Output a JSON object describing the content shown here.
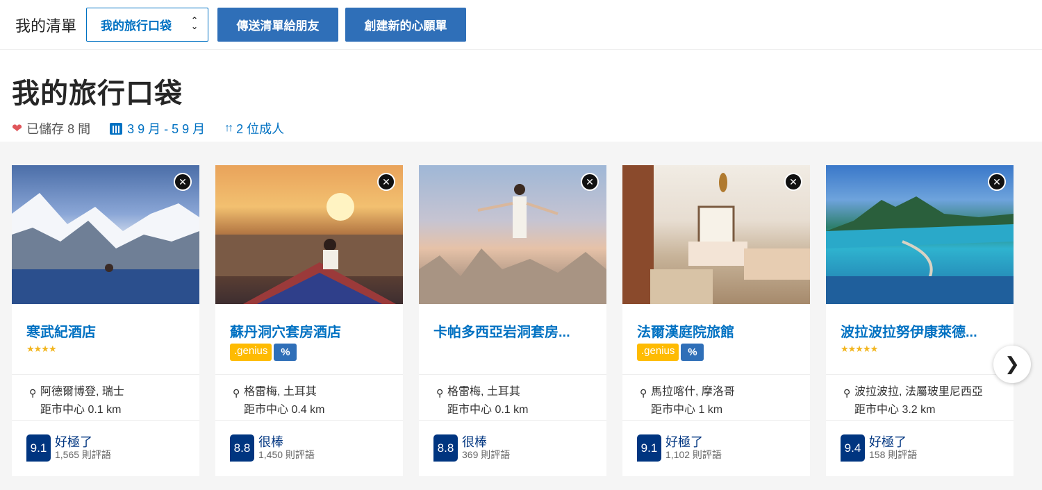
{
  "topbar": {
    "list_label": "我的清單",
    "select_value": "我的旅行口袋",
    "send_button": "傳送清單給朋友",
    "create_button": "創建新的心願單"
  },
  "header": {
    "title": "我的旅行口袋",
    "saved": "已儲存 8 間",
    "dates": "3 9 月 - 5 9 月",
    "guests": "2 位成人"
  },
  "cards": [
    {
      "name": "寒武紀酒店",
      "stars": "★★★★",
      "genius": "",
      "percent": "",
      "location": "阿德爾博登, 瑞士",
      "distance": "距市中心 0.1 km",
      "score": "9.1",
      "score_word": "好極了",
      "reviews": "1,565 則評語"
    },
    {
      "name": "蘇丹洞穴套房酒店",
      "stars": "",
      "genius": ".genius",
      "percent": "%",
      "location": "格雷梅, 土耳其",
      "distance": "距市中心 0.4 km",
      "score": "8.8",
      "score_word": "很棒",
      "reviews": "1,450 則評語"
    },
    {
      "name": "卡帕多西亞岩洞套房...",
      "stars": "",
      "genius": "",
      "percent": "",
      "location": "格雷梅, 土耳其",
      "distance": "距市中心 0.1 km",
      "score": "8.8",
      "score_word": "很棒",
      "reviews": "369 則評語"
    },
    {
      "name": "法爾漢庭院旅館",
      "stars": "",
      "genius": ".genius",
      "percent": "%",
      "location": "馬拉喀什, 摩洛哥",
      "distance": "距市中心 1 km",
      "score": "9.1",
      "score_word": "好極了",
      "reviews": "1,102 則評語"
    },
    {
      "name": "波拉波拉努伊康萊德...",
      "stars": "★★★★★",
      "genius": "",
      "percent": "",
      "location": "波拉波拉, 法屬玻里尼西亞",
      "distance": "距市中心 3.2 km",
      "score": "9.4",
      "score_word": "好極了",
      "reviews": "158 則評語"
    }
  ],
  "icons": {
    "close": "close-icon",
    "next": "chevron-right-icon",
    "pin": "map-pin-icon",
    "heart": "heart-icon",
    "calendar": "calendar-icon",
    "people": "people-icon"
  },
  "colors": {
    "primary": "#0071c2",
    "button": "#2f6fb8",
    "score": "#003580",
    "genius": "#febb02",
    "heart": "#e0565b"
  }
}
